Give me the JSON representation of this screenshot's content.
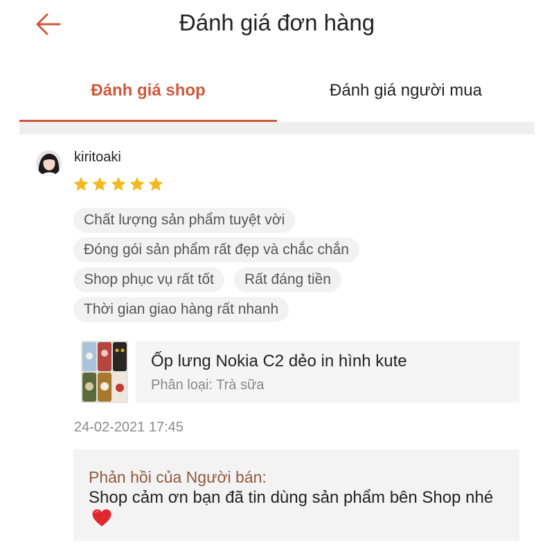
{
  "header": {
    "title": "Đánh giá đơn hàng",
    "back_icon": "arrow-left-icon",
    "accent_color": "#d0583a"
  },
  "tabs": [
    {
      "label": "Đánh giá shop",
      "active": true
    },
    {
      "label": "Đánh giá người mua",
      "active": false
    }
  ],
  "review": {
    "username": "kiritoaki",
    "rating": 5,
    "max_rating": 5,
    "star_color": "#f5b81d",
    "tags": [
      "Chất lượng sản phẩm tuyệt vời",
      "Đóng gói sản phẩm rất đẹp và chắc chắn",
      "Shop phục vụ rất tốt",
      "Rất đáng tiền",
      "Thời gian giao hàng rất nhanh"
    ],
    "timestamp": "24-02-2021 17:45"
  },
  "product": {
    "name": "Ốp lưng Nokia C2 dẻo in hình kute",
    "variant": "Phân loại: Trà sữa"
  },
  "seller_reply": {
    "title": "Phản hồi của Người bán:",
    "text": "Shop cảm ơn bạn đã tin dùng sản phẩm bên Shop nhé",
    "emoji_icon": "red-heart-icon"
  }
}
